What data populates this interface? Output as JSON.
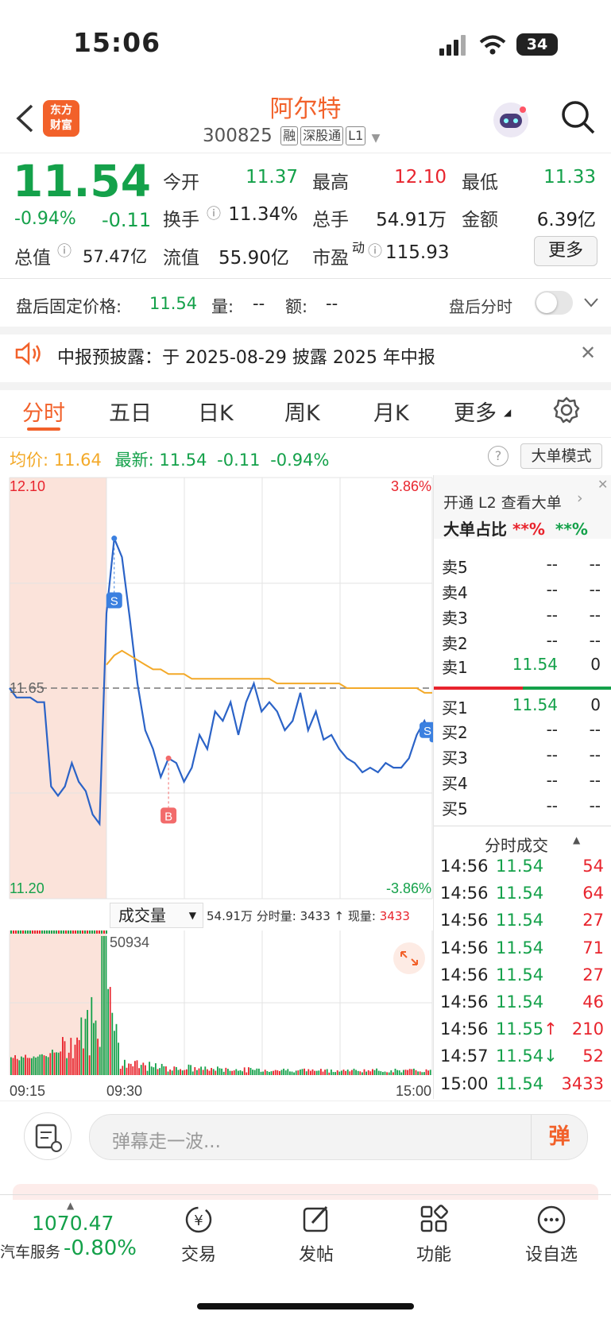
{
  "status_bar": {
    "time": "15:06",
    "battery": "34"
  },
  "header": {
    "logo_line1": "东方",
    "logo_line2": "财富",
    "title": "阿尔特",
    "code": "300825",
    "tags": [
      "融",
      "深股通",
      "L1"
    ]
  },
  "quote": {
    "price": "11.54",
    "change_pct": "-0.94%",
    "change": "-0.11",
    "open_label": "今开",
    "open": "11.37",
    "high_label": "最高",
    "high": "12.10",
    "low_label": "最低",
    "low": "11.33",
    "turnover_label": "换手",
    "turnover": "11.34%",
    "volume_label": "总手",
    "volume": "54.91万",
    "amount_label": "金额",
    "amount": "6.39亿",
    "mcap_label": "总值",
    "mcap": "57.47亿",
    "float_label": "流值",
    "float": "55.90亿",
    "pe_label": "市盈",
    "pe_sup": "动",
    "pe": "115.93",
    "more": "更多"
  },
  "after_hours": {
    "label": "盘后固定价格:",
    "price": "11.54",
    "vol_label": "量:",
    "vol": "--",
    "amt_label": "额:",
    "amt": "--",
    "toggle_label": "盘后分时"
  },
  "notice": {
    "text": "中报预披露：于 2025-08-29 披露 2025 年中报"
  },
  "tabs": [
    "分时",
    "五日",
    "日K",
    "周K",
    "月K",
    "更多"
  ],
  "info_line": {
    "avg_label": "均价:",
    "avg": "11.64",
    "latest_label": "最新:",
    "latest": "11.54",
    "chg": "-0.11",
    "pct": "-0.94%",
    "mode_btn": "大单模式"
  },
  "chart_data": [
    {
      "type": "line",
      "title": "",
      "y_labels": {
        "top": "12.10",
        "bottom": "11.20",
        "ref": "11.65",
        "top_pct": "3.86%",
        "bottom_pct": "-3.86%"
      },
      "ylim": [
        11.2,
        12.1
      ],
      "x": [
        "09:15",
        "09:30",
        "15:00"
      ],
      "series": [
        {
          "name": "",
          "values": [
            11.65,
            11.63,
            11.63,
            11.63,
            11.62,
            11.62,
            11.44,
            11.42,
            11.44,
            11.49,
            11.45,
            11.43,
            11.38,
            11.36,
            11.81,
            11.97,
            11.93,
            11.8,
            11.66,
            11.56,
            11.52,
            11.46,
            11.5,
            11.49,
            11.45,
            11.48,
            11.55,
            11.52,
            11.6,
            11.58,
            11.62,
            11.55,
            11.62,
            11.66,
            11.6,
            11.62,
            11.6,
            11.56,
            11.58,
            11.64,
            11.56,
            11.6,
            11.54,
            11.55,
            11.52,
            11.5,
            11.49,
            11.47,
            11.48,
            11.47,
            11.49,
            11.48,
            11.48,
            11.5,
            11.55,
            11.58,
            11.54
          ]
        },
        {
          "name": "",
          "values": [
            null,
            null,
            null,
            null,
            null,
            null,
            null,
            null,
            null,
            null,
            null,
            null,
            null,
            null,
            11.7,
            11.72,
            11.73,
            11.72,
            11.71,
            11.7,
            11.69,
            11.69,
            11.68,
            11.68,
            11.68,
            11.67,
            11.67,
            11.67,
            11.67,
            11.67,
            11.67,
            11.67,
            11.67,
            11.67,
            11.67,
            11.67,
            11.66,
            11.66,
            11.66,
            11.66,
            11.66,
            11.66,
            11.66,
            11.66,
            11.66,
            11.65,
            11.65,
            11.65,
            11.65,
            11.65,
            11.65,
            11.65,
            11.65,
            11.65,
            11.65,
            11.64,
            11.64
          ]
        }
      ],
      "markers": [
        "S",
        "B",
        "S"
      ]
    },
    {
      "type": "bar",
      "title": "成交量",
      "summary": "54.91万",
      "min_vol_label": "分时量:",
      "min_vol": "3433",
      "cur_vol_label": "现量:",
      "cur_vol": "3433",
      "max_label": "50934",
      "x_ticks": [
        "09:15",
        "09:30",
        "15:00"
      ]
    }
  ],
  "side_panel": {
    "l2_link": "开通 L2 查看大单",
    "big_order_label": "大单占比",
    "big_order_buy": "**%",
    "big_order_sell": "**%",
    "asks": [
      {
        "label": "卖5",
        "price": "--",
        "vol": "--"
      },
      {
        "label": "卖4",
        "price": "--",
        "vol": "--"
      },
      {
        "label": "卖3",
        "price": "--",
        "vol": "--"
      },
      {
        "label": "卖2",
        "price": "--",
        "vol": "--"
      },
      {
        "label": "卖1",
        "price": "11.54",
        "vol": "0"
      }
    ],
    "bids": [
      {
        "label": "买1",
        "price": "11.54",
        "vol": "0"
      },
      {
        "label": "买2",
        "price": "--",
        "vol": "--"
      },
      {
        "label": "买3",
        "price": "--",
        "vol": "--"
      },
      {
        "label": "买4",
        "price": "--",
        "vol": "--"
      },
      {
        "label": "买5",
        "price": "--",
        "vol": "--"
      }
    ],
    "trades_title": "分时成交",
    "trades": [
      {
        "time": "14:56",
        "price": "11.54",
        "vol": "54",
        "arrow": ""
      },
      {
        "time": "14:56",
        "price": "11.54",
        "vol": "64",
        "arrow": ""
      },
      {
        "time": "14:56",
        "price": "11.54",
        "vol": "27",
        "arrow": ""
      },
      {
        "time": "14:56",
        "price": "11.54",
        "vol": "71",
        "arrow": ""
      },
      {
        "time": "14:56",
        "price": "11.54",
        "vol": "27",
        "arrow": ""
      },
      {
        "time": "14:56",
        "price": "11.54",
        "vol": "46",
        "arrow": ""
      },
      {
        "time": "14:56",
        "price": "11.55",
        "vol": "210",
        "arrow": "↑"
      },
      {
        "time": "14:57",
        "price": "11.54",
        "vol": "52",
        "arrow": "↓"
      },
      {
        "time": "15:00",
        "price": "11.54",
        "vol": "3433",
        "arrow": ""
      }
    ]
  },
  "comment": {
    "placeholder": "弹幕走一波...",
    "danmu": "弹"
  },
  "bottom_bar": {
    "index_value": "1070.47",
    "index_name": "汽车服务",
    "index_pct": "-0.80%",
    "trade": "交易",
    "post": "发帖",
    "func": "功能",
    "add_watch": "设自选"
  }
}
